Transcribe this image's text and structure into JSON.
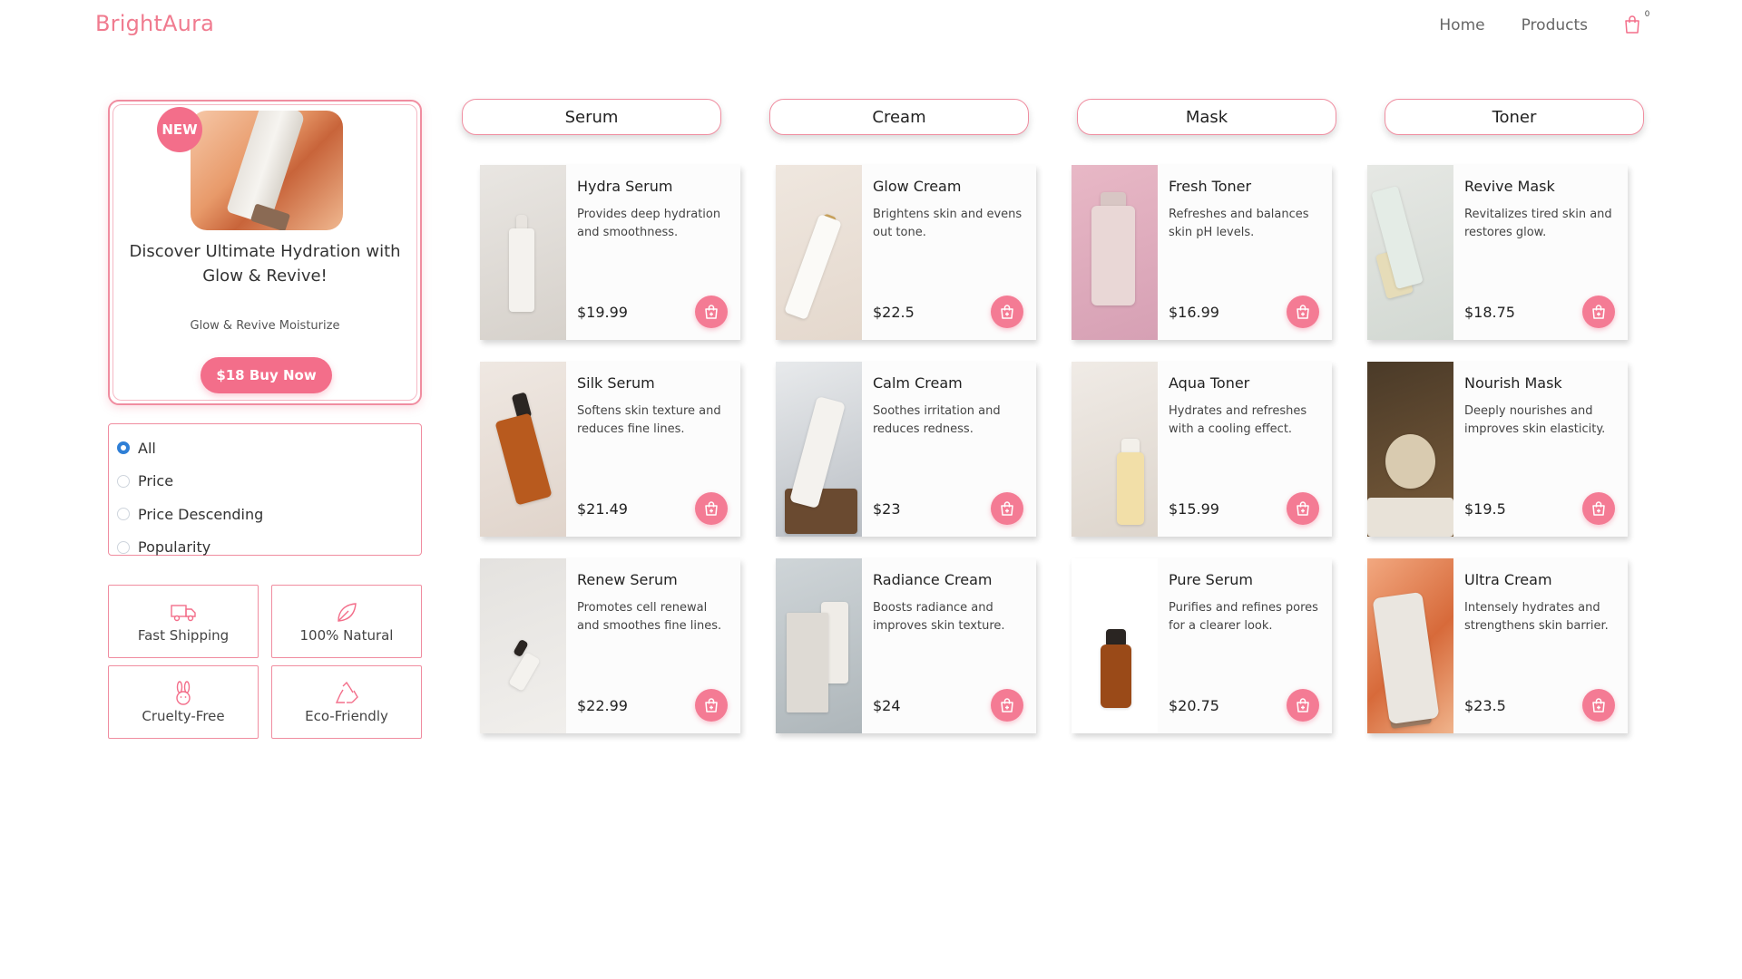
{
  "header": {
    "brand": "BrightAura",
    "nav": [
      "Home",
      "Products"
    ],
    "cart_count": "0"
  },
  "promo": {
    "badge": "NEW",
    "title": "Discover Ultimate Hydration with Glow & Revive!",
    "subtitle": "Glow & Revive Moisturize",
    "button": "$18 Buy Now"
  },
  "filters": {
    "options": [
      "All",
      "Price",
      "Price Descending",
      "Popularity"
    ],
    "selected": "All"
  },
  "features": [
    {
      "label": "Fast Shipping",
      "icon": "truck-icon"
    },
    {
      "label": "100% Natural",
      "icon": "leaf-icon"
    },
    {
      "label": "Cruelty-Free",
      "icon": "rabbit-icon"
    },
    {
      "label": "Eco-Friendly",
      "icon": "recycle-icon"
    }
  ],
  "categories": [
    "Serum",
    "Cream",
    "Mask",
    "Toner"
  ],
  "products": [
    {
      "name": "Hydra Serum",
      "desc": "Provides deep hydration and smoothness.",
      "price": "$19.99"
    },
    {
      "name": "Glow Cream",
      "desc": "Brightens skin and evens out tone.",
      "price": "$22.5"
    },
    {
      "name": "Fresh Toner",
      "desc": "Refreshes and balances skin pH levels.",
      "price": "$16.99"
    },
    {
      "name": "Revive Mask",
      "desc": "Revitalizes tired skin and restores glow.",
      "price": "$18.75"
    },
    {
      "name": "Silk Serum",
      "desc": "Softens skin texture and reduces fine lines.",
      "price": "$21.49"
    },
    {
      "name": "Calm Cream",
      "desc": "Soothes irritation and reduces redness.",
      "price": "$23"
    },
    {
      "name": "Aqua Toner",
      "desc": "Hydrates and refreshes with a cooling effect.",
      "price": "$15.99"
    },
    {
      "name": "Nourish Mask",
      "desc": "Deeply nourishes and improves skin elasticity.",
      "price": "$19.5"
    },
    {
      "name": "Renew Serum",
      "desc": "Promotes cell renewal and smoothes fine lines.",
      "price": "$22.99"
    },
    {
      "name": "Radiance Cream",
      "desc": "Boosts radiance and improves skin texture.",
      "price": "$24"
    },
    {
      "name": "Pure Serum",
      "desc": "Purifies and refines pores for a clearer look.",
      "price": "$20.75"
    },
    {
      "name": "Ultra Cream",
      "desc": "Intensely hydrates and strengthens skin barrier.",
      "price": "$23.5"
    }
  ],
  "colors": {
    "accent": "#f36e8a",
    "border": "#f08da0",
    "radio": "#2f7fd6"
  }
}
